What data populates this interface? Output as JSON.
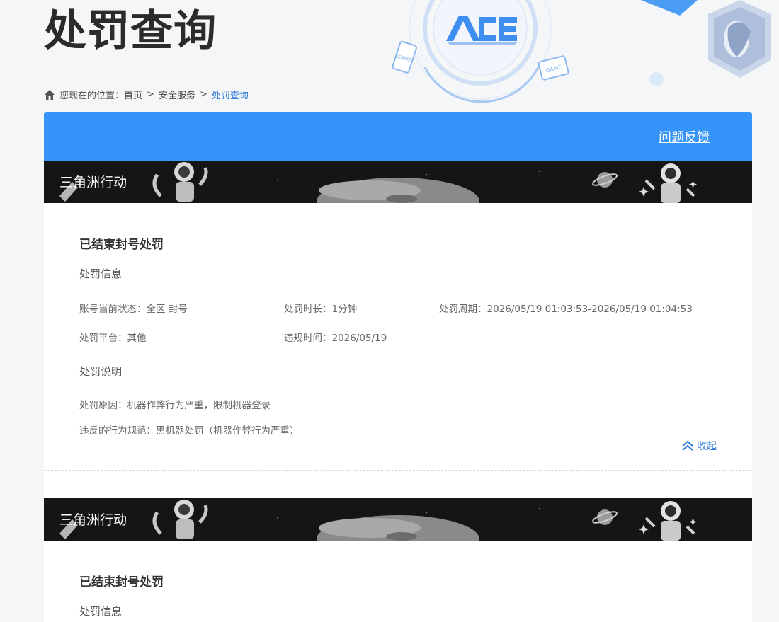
{
  "page": {
    "title": "处罚查询"
  },
  "breadcrumb": {
    "prefix": "您现在的位置：",
    "items": [
      "首页",
      "安全服务",
      "处罚查询"
    ],
    "separator": ">"
  },
  "header_deco": {
    "badge_text": "GAME",
    "badge_text_2": "GAME",
    "logo_text": "ACE"
  },
  "top_bar": {
    "feedback_label": "问题反馈"
  },
  "records": [
    {
      "game": "三角洲行动",
      "status": "已结束封号处罚",
      "info_title": "处罚信息",
      "fields": {
        "account_status": "账号当前状态：全区 封号",
        "duration": "处罚时长：1分钟",
        "period": "处罚周期：2026/05/19 01:03:53-2026/05/19 01:04:53",
        "platform": "处罚平台：其他",
        "violation_time": "违规时间：2026/05/19"
      },
      "desc_title": "处罚说明",
      "reason": "处罚原因：机器作弊行为严重，限制机器登录",
      "rule": "违反的行为规范：黑机器处罚（机器作弊行为严重）",
      "collapse_label": "收起"
    },
    {
      "game": "三角洲行动",
      "status": "已结束封号处罚",
      "info_title": "处罚信息"
    }
  ],
  "colors": {
    "accent": "#3494f9",
    "link": "#2d7ad6",
    "banner_bg": "#151515"
  }
}
